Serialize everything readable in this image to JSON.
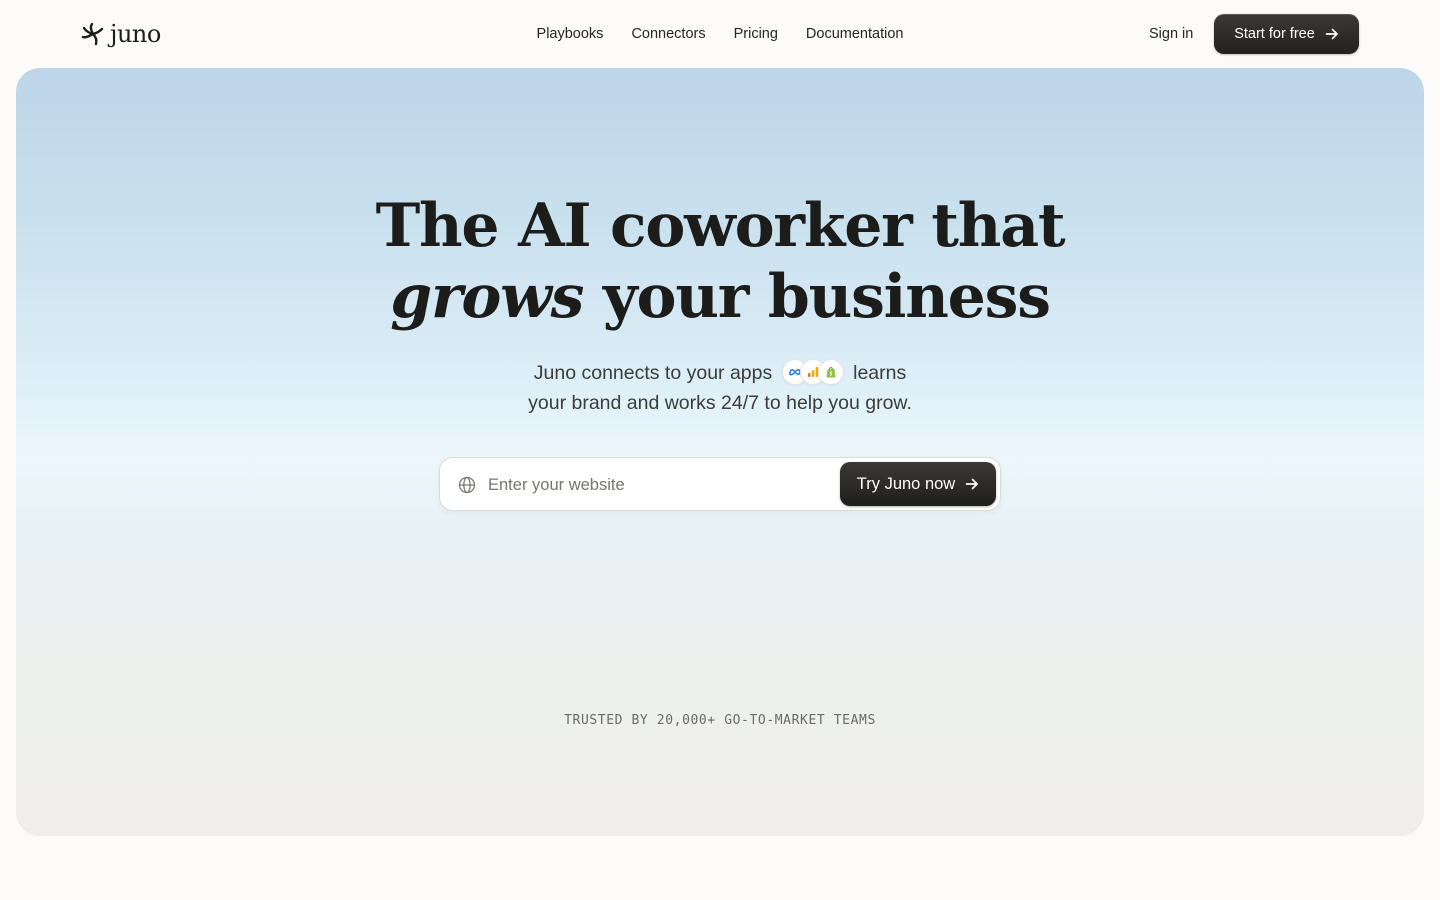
{
  "brand": {
    "name": "juno"
  },
  "nav": {
    "items": [
      {
        "label": "Playbooks"
      },
      {
        "label": "Connectors"
      },
      {
        "label": "Pricing"
      },
      {
        "label": "Documentation"
      }
    ]
  },
  "header": {
    "signin_label": "Sign in",
    "cta_label": "Start for free"
  },
  "hero": {
    "headline_line1": "The AI coworker that",
    "headline_accent": "grows",
    "headline_line2_rest": " your business",
    "sub_part1": "Juno connects to your apps",
    "sub_part2": "learns",
    "sub_line2": "your brand and works 24/7 to help you grow.",
    "app_icons": [
      "meta-icon",
      "analytics-icon",
      "shopify-icon"
    ],
    "search": {
      "placeholder": "Enter your website",
      "value": ""
    },
    "try_label": "Try Juno now",
    "trusted_text": "TRUSTED BY 20,000+ GO-TO-MARKET TEAMS"
  },
  "colors": {
    "button_dark": "#2b2a27",
    "background": "#fcfbf9",
    "hero_top": "#bcd6e8",
    "hero_bottom": "#f0eeea"
  }
}
